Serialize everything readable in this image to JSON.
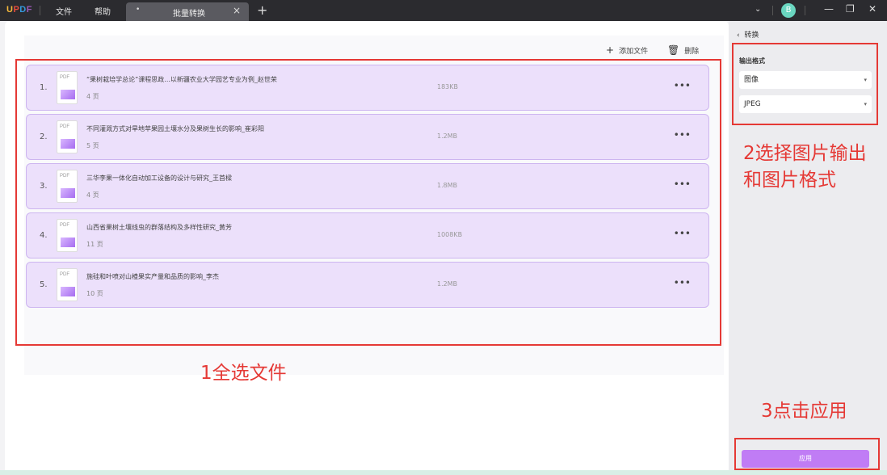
{
  "app": {
    "logo": {
      "u": "U",
      "p": "P",
      "d": "D",
      "f": "F"
    },
    "menu": [
      "文件",
      "帮助"
    ],
    "tab_label": "批量转换",
    "avatar_letter": "B"
  },
  "toolbar": {
    "add_file": "添加文件",
    "delete": "删除"
  },
  "files": [
    {
      "index": "1.",
      "name": "“果树栽培学总论”课程思政...以新疆农业大学园艺专业为例_赵世荣",
      "pages": "4 页",
      "size": "183KB"
    },
    {
      "index": "2.",
      "name": "不同灌溉方式对旱地苹果园土壤水分及果树生长的影响_崔彩阳",
      "pages": "5 页",
      "size": "1.2MB"
    },
    {
      "index": "3.",
      "name": "三华李果一体化自动加工设备的设计与研究_王首樑",
      "pages": "4 页",
      "size": "1.8MB"
    },
    {
      "index": "4.",
      "name": "山西省果树土壤线虫的群落结构及多样性研究_黄芳",
      "pages": "11 页",
      "size": "1008KB"
    },
    {
      "index": "5.",
      "name": "施硅和叶喷对山楂果实产量和品质的影响_李杰",
      "pages": "10 页",
      "size": "1.2MB"
    }
  ],
  "panel": {
    "back_title": "转换",
    "output_label": "输出格式",
    "format_type": "图像",
    "image_format": "JPEG",
    "apply_label": "应用"
  },
  "annotations": {
    "step1": "1全选文件",
    "step2_line1": "2选择图片输出",
    "step2_line2": "和图片格式",
    "step3": "3点击应用"
  },
  "colors": {
    "titlebar": "#2b2b2f",
    "row_fill": "#ece0fb",
    "apply_button": "#c07cf5",
    "annotation_red": "#e53935"
  }
}
